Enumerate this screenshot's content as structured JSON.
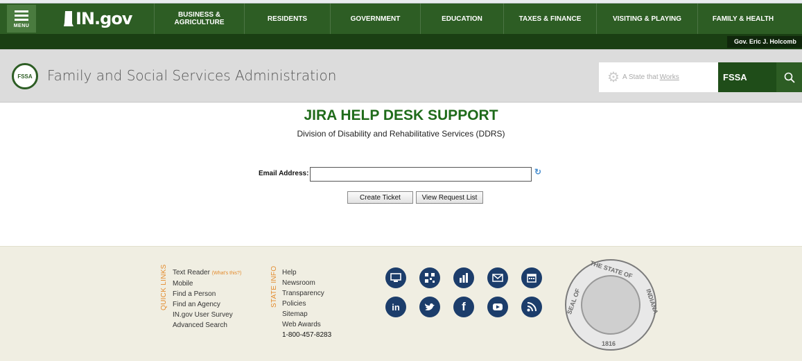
{
  "nav": {
    "menu_label": "MENU",
    "logo_text": "IN.gov",
    "items": [
      {
        "label": "BUSINESS & AGRICULTURE"
      },
      {
        "label": "RESIDENTS"
      },
      {
        "label": "GOVERNMENT"
      },
      {
        "label": "EDUCATION"
      },
      {
        "label": "TAXES & FINANCE"
      },
      {
        "label": "VISITING & PLAYING"
      },
      {
        "label": "FAMILY & HEALTH"
      }
    ]
  },
  "govbar": {
    "governor": "Gov. Eric J. Holcomb"
  },
  "header": {
    "seal_initials": "FSSA",
    "agency_name": "Family and Social Services Administration",
    "tagline_prefix": "A State that",
    "tagline_emphasis": "Works",
    "search_value": "FSSA"
  },
  "main": {
    "title": "JIRA HELP DESK SUPPORT",
    "subtitle": "Division of Disability and Rehabilitative Services (DDRS)",
    "email_label": "Email Address:",
    "email_value": "",
    "create_button": "Create Ticket",
    "view_button": "View Request List"
  },
  "footer": {
    "quick_links_label": "QUICK LINKS",
    "state_info_label": "STATE INFO",
    "quick_links": [
      {
        "label": "Text Reader",
        "note": "(What's this?)"
      },
      {
        "label": "Mobile"
      },
      {
        "label": "Find a Person"
      },
      {
        "label": "Find an Agency"
      },
      {
        "label": "IN.gov User Survey"
      },
      {
        "label": "Advanced Search"
      }
    ],
    "state_info": [
      {
        "label": "Help"
      },
      {
        "label": "Newsroom"
      },
      {
        "label": "Transparency"
      },
      {
        "label": "Policies"
      },
      {
        "label": "Sitemap"
      },
      {
        "label": "Web Awards"
      }
    ],
    "phone": "1-800-457-8283",
    "social_icons": [
      "desktop-icon",
      "qr-code-icon",
      "bar-chart-icon",
      "email-icon",
      "calendar-icon",
      "linkedin-icon",
      "twitter-icon",
      "facebook-icon",
      "youtube-icon",
      "rss-icon"
    ],
    "seal_top_text": "THE STATE OF",
    "seal_side_text": "SEAL OF",
    "seal_right_text": "INDIANA",
    "seal_year": "1816"
  },
  "colors": {
    "nav_green": "#2d5d24",
    "title_green": "#1f6b1a",
    "footer_bg": "#f0eee2",
    "social_blue": "#1c3d6b",
    "link_orange": "#e38a2b"
  }
}
